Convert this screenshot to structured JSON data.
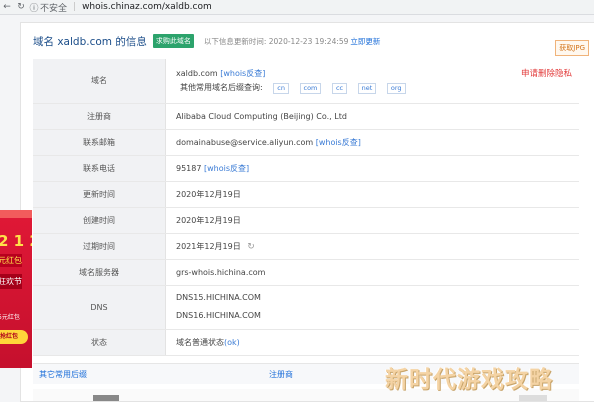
{
  "browser": {
    "back_icon": "←",
    "reload_icon": "↻",
    "warning_icon": "ⓘ",
    "insecure": "不安全",
    "separator": "|",
    "url": "whois.chinaz.com/xaldb.com"
  },
  "header": {
    "title": "域名 xaldb.com 的信息",
    "buy_badge": "求购此域名",
    "update_text": "以下信息更新时间: 2020-12-23 19:24:59",
    "update_link": "立即更新",
    "reward_button": "获取JPG"
  },
  "rows": {
    "domain": {
      "label": "域名",
      "value": "xaldb.com",
      "link": "[whois反查]",
      "privacy": "申请删除隐私",
      "suffix_label": "其他常用域名后缀查询:",
      "suffixes": {
        "cn": "cn",
        "com": "com",
        "cc": "cc",
        "net": "net",
        "org": "org"
      }
    },
    "registrar": {
      "label": "注册商",
      "value": "Alibaba Cloud Computing (Beijing) Co., Ltd"
    },
    "email": {
      "label": "联系邮箱",
      "value": "domainabuse@service.aliyun.com",
      "link": "[whois反查]"
    },
    "phone": {
      "label": "联系电话",
      "value": "95187",
      "link": "[whois反查]"
    },
    "updated": {
      "label": "更新时间",
      "value": "2020年12月19日"
    },
    "created": {
      "label": "创建时间",
      "value": "2020年12月19日"
    },
    "expires": {
      "label": "过期时间",
      "value": "2021年12月19日"
    },
    "whois_server": {
      "label": "域名服务器",
      "value": "grs-whois.hichina.com"
    },
    "dns": {
      "label": "DNS",
      "value1": "DNS15.HICHINA.COM",
      "value2": "DNS16.HICHINA.COM"
    },
    "status": {
      "label": "状态",
      "value": "域名普通状态",
      "ok": "(ok)"
    }
  },
  "bottom_tabs": {
    "other": "其它常用后缀",
    "registrar": "注册商"
  },
  "side_ad": {
    "number": "2 1 2",
    "line1": "元红包",
    "line2": "狂欢节",
    "line3": "5元红包",
    "button": "抢红包"
  },
  "watermark": "新时代游戏攻略",
  "colors": {
    "accent_blue": "#1e6fd9",
    "badge_green": "#2ca36c",
    "privacy_red": "#e23b3b",
    "ad_red": "#e01836"
  }
}
